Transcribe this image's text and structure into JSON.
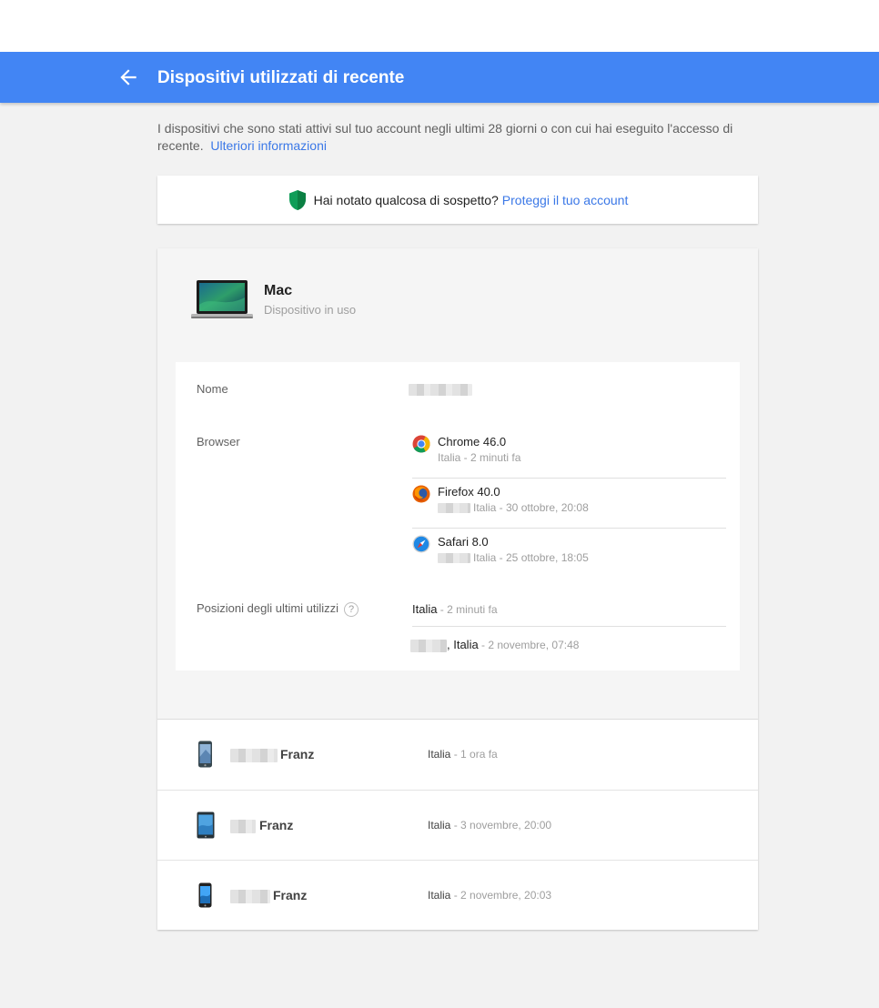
{
  "header": {
    "title": "Dispositivi utilizzati di recente"
  },
  "intro": {
    "text": "I dispositivi che sono stati attivi sul tuo account negli ultimi 28 giorni o con cui hai eseguito l'accesso di recente.",
    "link": "Ulteriori informazioni"
  },
  "suspicious": {
    "text": "Hai notato qualcosa di sospetto?",
    "link": "Proteggi il tuo account"
  },
  "current_device": {
    "name": "Mac",
    "status": "Dispositivo in uso",
    "labels": {
      "name": "Nome",
      "browser": "Browser",
      "locations": "Posizioni degli ultimi utilizzi"
    },
    "help_glyph": "?",
    "browsers": [
      {
        "name": "Chrome 46.0",
        "meta": "Italia - 2 minuti fa",
        "icon": "chrome-icon"
      },
      {
        "name": "Firefox 40.0",
        "meta": "Italia - 30 ottobre, 20:08",
        "icon": "firefox-icon"
      },
      {
        "name": "Safari 8.0",
        "meta": "Italia - 25 ottobre, 18:05",
        "icon": "safari-icon"
      }
    ],
    "locations": [
      {
        "place": "Italia",
        "time": " - 2 minuti fa"
      },
      {
        "place": ", Italia",
        "time": " - 2 novembre, 07:48"
      }
    ]
  },
  "other_devices": [
    {
      "name": "Franz",
      "place": "Italia",
      "time": " - 1 ora fa"
    },
    {
      "name": "Franz",
      "place": "Italia",
      "time": " - 3 novembre, 20:00"
    },
    {
      "name": "Franz",
      "place": "Italia",
      "time": " - 2 novembre, 20:03"
    }
  ],
  "colors": {
    "appbar": "#4285f4",
    "link": "#3b78e7",
    "shield": "#0f9d58"
  }
}
